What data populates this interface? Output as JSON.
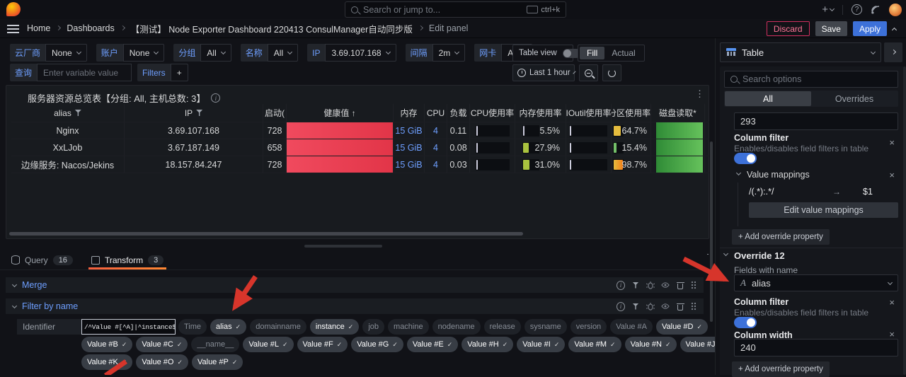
{
  "icons": {
    "check": "✓",
    "sort_up": "↑",
    "close": "×",
    "kebab": "⋮",
    "arrow_right": "→",
    "plus": "+",
    "question": "?",
    "info": "i"
  },
  "topbar": {
    "search_placeholder": "Search or jump to...",
    "shortcut": "ctrl+k"
  },
  "breadcrumb": {
    "items": [
      "Home",
      "Dashboards",
      "【测试】 Node Exporter Dashboard 220413 ConsulManager自动同步版",
      "Edit panel"
    ]
  },
  "actions": {
    "discard": "Discard",
    "save": "Save",
    "apply": "Apply"
  },
  "variables": {
    "items": [
      {
        "label": "云厂商",
        "value": "None"
      },
      {
        "label": "账户",
        "value": "None"
      },
      {
        "label": "分组",
        "value": "All"
      },
      {
        "label": "名称",
        "value": "All"
      },
      {
        "label": "IP",
        "value": "3.69.107.168"
      },
      {
        "label": "间隔",
        "value": "2m"
      },
      {
        "label": "网卡",
        "value": "All"
      }
    ],
    "query_label": "查询",
    "query_placeholder": "Enter variable value",
    "filters_label": "Filters",
    "add": "+"
  },
  "panel_controls": {
    "table_view": "Table view",
    "fill": "Fill",
    "actual": "Actual",
    "time_range": "Last 1 hour"
  },
  "panel": {
    "title": "服务器资源总览表【分组: All, 主机总数: 3】"
  },
  "table": {
    "headers": [
      "alias",
      "IP",
      "启动(",
      "健康值",
      "内存",
      "CPU",
      "负载",
      "CPU使用率",
      "内存使用率",
      "IOutil使用率",
      "分区使用率*",
      "磁盘读取*",
      "磁"
    ],
    "health_color": "linear-gradient(90deg,#f04a5e,#e23548)",
    "disk_color": "linear-gradient(90deg,#2f8b36,#66c25c)",
    "rows": [
      {
        "alias": "Nginx",
        "ip": "3.69.107.168",
        "uptime": "728",
        "mem": "15 GiB",
        "cpu": "4",
        "load": "0.11",
        "cpu_bar": "2px",
        "cpu_bar_color": "#ccccdc",
        "mem_use": "5.5%",
        "mem_bar": "2px",
        "mem_bar_color": "#ccccdc",
        "io_bar": "2px",
        "part_use": "64.7%",
        "part_bar": "10px",
        "part_bar_color": "#E5BC3E"
      },
      {
        "alias": "XxLJob",
        "ip": "3.67.187.149",
        "uptime": "658",
        "mem": "15 GiB",
        "cpu": "4",
        "load": "0.08",
        "cpu_bar": "2px",
        "cpu_bar_color": "#ccccdc",
        "mem_use": "27.9%",
        "mem_bar": "8px",
        "mem_bar_color": "#a9c23f",
        "io_bar": "2px",
        "part_use": "15.4%",
        "part_bar": "4px",
        "part_bar_color": "#73BF69"
      },
      {
        "alias": "边缘服务: Nacos/Jekins",
        "ip": "18.157.84.247",
        "uptime": "728",
        "mem": "15 GiB",
        "cpu": "4",
        "load": "0.03",
        "cpu_bar": "2px",
        "cpu_bar_color": "#ccccdc",
        "mem_use": "31.0%",
        "mem_bar": "9px",
        "mem_bar_color": "#a9c23f",
        "io_bar": "2px",
        "part_use": "98.7%",
        "part_bar": "13px",
        "part_bar_color": "linear-gradient(90deg,#E5BC3E,#F2801B)"
      }
    ]
  },
  "tabs": {
    "query": "Query",
    "query_count": "16",
    "transform": "Transform",
    "transform_count": "3"
  },
  "transforms": {
    "merge": "Merge",
    "filter": "Filter by name",
    "identifier_label": "Identifier",
    "regex": "/^Value #[^A]|^instance$|^n"
  },
  "pills": {
    "r1": [
      {
        "t": "Time"
      },
      {
        "t": "alias"
      },
      {
        "t": "domainname"
      },
      {
        "t": "instance"
      },
      {
        "t": "job"
      },
      {
        "t": "machine"
      },
      {
        "t": "nodename"
      },
      {
        "t": "release"
      },
      {
        "t": "sysname"
      },
      {
        "t": "version"
      },
      {
        "t": "Value #A"
      },
      {
        "t": "Value #D"
      }
    ],
    "r2": [
      {
        "t": "Value #B"
      },
      {
        "t": "Value #C"
      },
      {
        "t": "__name__"
      },
      {
        "t": "Value #L"
      },
      {
        "t": "Value #F"
      },
      {
        "t": "Value #G"
      },
      {
        "t": "Value #E"
      },
      {
        "t": "Value #H"
      },
      {
        "t": "Value #I"
      },
      {
        "t": "Value #M"
      },
      {
        "t": "Value #N"
      },
      {
        "t": "Value #J"
      }
    ],
    "r3": [
      {
        "t": "Value #K"
      },
      {
        "t": "Value #O"
      },
      {
        "t": "Value #P"
      }
    ]
  },
  "sidebar": {
    "viz": "Table",
    "search_placeholder": "Search options",
    "tabs": {
      "all": "All",
      "overrides": "Overrides"
    },
    "width_value": "293",
    "column_filter": {
      "label": "Column filter",
      "desc": "Enables/disables field filters in table"
    },
    "value_mappings": {
      "label": "Value mappings",
      "pattern": "/(.*):.*/",
      "replacement": "$1",
      "edit": "Edit value mappings"
    },
    "add_override": "+ Add override property",
    "override": {
      "title": "Override 12",
      "fields_label": "Fields with name",
      "field_value": "alias",
      "column_width_label": "Column width",
      "column_width_value": "240"
    }
  }
}
